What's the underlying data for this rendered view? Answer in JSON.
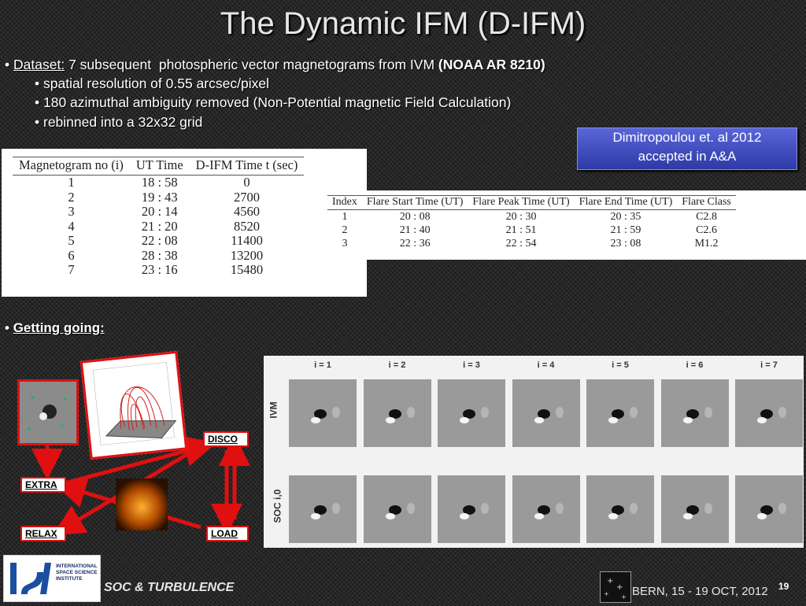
{
  "title": "The Dynamic IFM (D-IFM)",
  "bullets": {
    "dataset_label": "Dataset:",
    "dataset_text": " 7 subsequent  photospheric vector magnetograms from IVM ",
    "dataset_bold": "(NOAA  AR 8210)",
    "sub1": "• spatial resolution of 0.55 arcsec/pixel",
    "sub2": "• 180 azimuthal ambiguity removed (Non-Potential magnetic Field Calculation)",
    "sub3": "• rebinned into a 32x32 grid",
    "bullet_mark": "•"
  },
  "citation": {
    "line1": "Dimitropoulou et. al 2012",
    "line2": "accepted in A&A"
  },
  "table1": {
    "headers": [
      "Magnetogram no (i)",
      "UT Time",
      "D-IFM Time t (sec)"
    ],
    "rows": [
      [
        "1",
        "18 : 58",
        "0"
      ],
      [
        "2",
        "19 : 43",
        "2700"
      ],
      [
        "3",
        "20 : 14",
        "4560"
      ],
      [
        "4",
        "21 : 20",
        "8520"
      ],
      [
        "5",
        "22 : 08",
        "11400"
      ],
      [
        "6",
        "28 : 38",
        "13200"
      ],
      [
        "7",
        "23 : 16",
        "15480"
      ]
    ]
  },
  "table2": {
    "headers": [
      "Index",
      "Flare Start Time (UT)",
      "Flare Peak Time (UT)",
      "Flare End Time (UT)",
      "Flare Class"
    ],
    "rows": [
      [
        "1",
        "20 : 08",
        "20 : 30",
        "20 : 35",
        "C2.8"
      ],
      [
        "2",
        "21 : 40",
        "21 : 51",
        "21 : 59",
        "C2.6"
      ],
      [
        "3",
        "22 : 36",
        "22 : 54",
        "23 : 08",
        "M1.2"
      ]
    ]
  },
  "section": {
    "label": "Getting going:"
  },
  "flow": {
    "disco": "DISCO",
    "extra": "EXTRA",
    "relax": "RELAX",
    "load": "LOAD"
  },
  "grid": {
    "cols": [
      "i = 1",
      "i = 2",
      "i = 3",
      "i = 4",
      "i = 5",
      "i = 6",
      "i = 7"
    ],
    "rows": [
      "IVM",
      "SOC i,0"
    ]
  },
  "footer": {
    "logo_text": "INTERNATIONAL SPACE SCIENCE INSTITUTE",
    "left": "SOC & TURBULENCE",
    "right": "BERN, 15 - 19 OCT, 2012",
    "page": "19"
  },
  "colors": {
    "arrow": "#e01010",
    "citation_box": "#4a56cc"
  }
}
